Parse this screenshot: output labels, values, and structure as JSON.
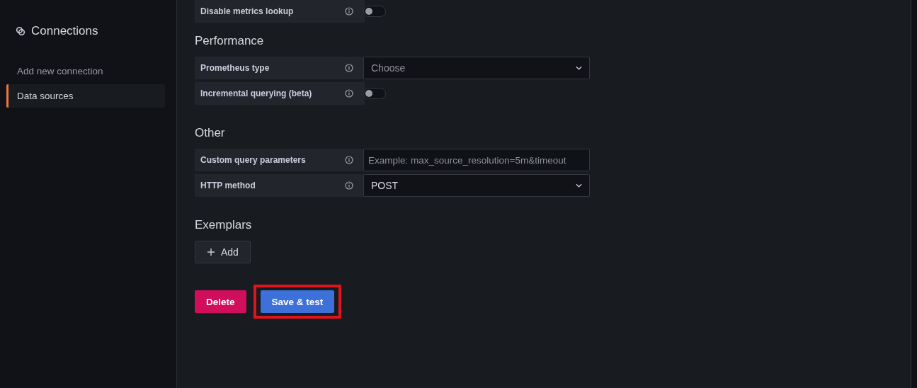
{
  "sidebar": {
    "title": "Connections",
    "items": [
      {
        "label": "Add new connection",
        "selected": false
      },
      {
        "label": "Data sources",
        "selected": true
      }
    ]
  },
  "sections": [
    {
      "rows": [
        {
          "label": "Disable metrics lookup",
          "kind": "toggle",
          "on": false
        }
      ]
    },
    {
      "title": "Performance",
      "rows": [
        {
          "label": "Prometheus type",
          "kind": "select",
          "placeholder": "Choose"
        },
        {
          "label": "Incremental querying (beta)",
          "kind": "toggle",
          "on": false
        }
      ]
    },
    {
      "title": "Other",
      "rows": [
        {
          "label": "Custom query parameters",
          "kind": "input",
          "placeholder": "Example: max_source_resolution=5m&timeout"
        },
        {
          "label": "HTTP method",
          "kind": "select",
          "value": "POST"
        }
      ]
    },
    {
      "title": "Exemplars",
      "add_button": "Add"
    }
  ],
  "actions": [
    {
      "label": "Delete",
      "kind": "danger"
    },
    {
      "label": "Save & test",
      "kind": "primary",
      "highlighted": true
    }
  ]
}
